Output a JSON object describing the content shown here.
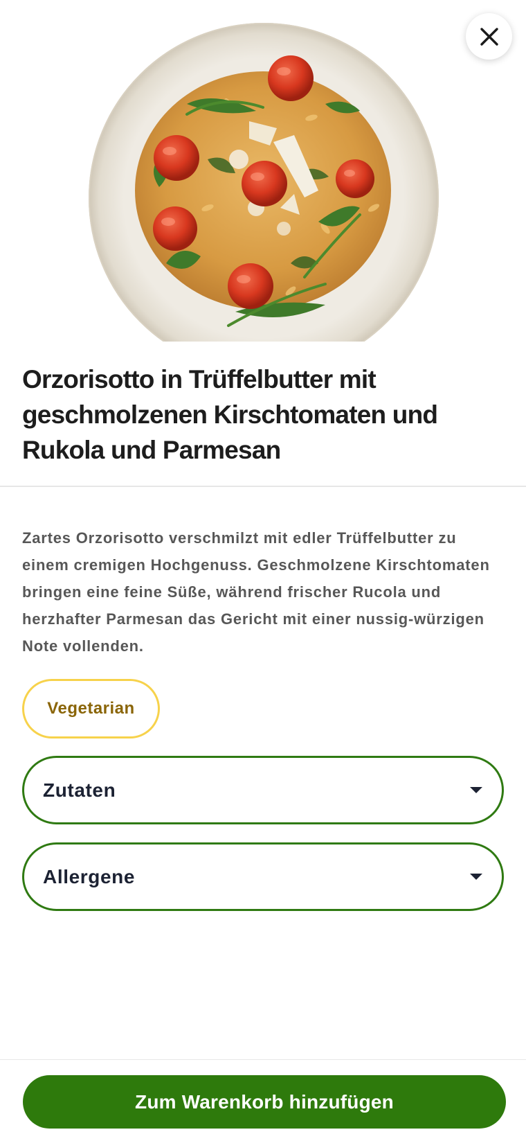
{
  "hero": {
    "image_alt": "Orzorisotto dish in a white bowl"
  },
  "header": {
    "close_icon": "close-icon"
  },
  "recipe": {
    "title": "Orzorisotto in Trüffelbutter mit geschmolzenen Kirschtomaten und Rukola und Parmesan",
    "description": "Zartes Orzorisotto verschmilzt mit edler Trüffelbutter zu einem cremigen Hochgenuss. Geschmolzene Kirschtomaten bringen eine feine Süße, während frischer Rucola und herzhafter Parmesan das Gericht mit einer nussig-würzigen Note vollenden.",
    "tag": "Vegetarian"
  },
  "accordions": {
    "ingredients_label": "Zutaten",
    "allergens_label": "Allergene",
    "caret_icon": "caret-down-icon"
  },
  "cta": {
    "label": "Zum Warenkorb hinzufügen"
  },
  "colors": {
    "brand_green": "#2e7a0c",
    "tag_border": "#f7d24b",
    "tag_text": "#8a6508"
  }
}
